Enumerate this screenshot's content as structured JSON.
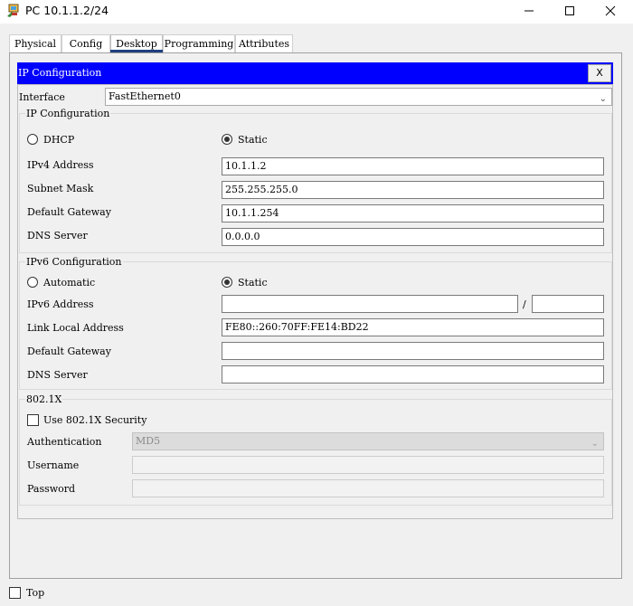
{
  "window": {
    "title": "PC 10.1.1.2/24"
  },
  "tabs": [
    "Physical",
    "Config",
    "Desktop",
    "Programming",
    "Attributes"
  ],
  "header": {
    "title": "IP Configuration",
    "close_label": "X"
  },
  "interface": {
    "label": "Interface",
    "value": "FastEthernet0"
  },
  "ipv4": {
    "group_title": "IP Configuration",
    "dhcp_label": "DHCP",
    "static_label": "Static",
    "address_label": "IPv4 Address",
    "address_value": "10.1.1.2",
    "mask_label": "Subnet Mask",
    "mask_value": "255.255.255.0",
    "gateway_label": "Default Gateway",
    "gateway_value": "10.1.1.254",
    "dns_label": "DNS Server",
    "dns_value": "0.0.0.0"
  },
  "ipv6": {
    "group_title": "IPv6 Configuration",
    "auto_label": "Automatic",
    "static_label": "Static",
    "address_label": "IPv6 Address",
    "address_value": "",
    "prefix_sep": "/",
    "prefix_value": "",
    "link_local_label": "Link Local Address",
    "link_local_value": "FE80::260:70FF:FE14:BD22",
    "gateway_label": "Default Gateway",
    "gateway_value": "",
    "dns_label": "DNS Server",
    "dns_value": ""
  },
  "dot1x": {
    "group_title": "802.1X",
    "use_label": "Use 802.1X Security",
    "auth_label": "Authentication",
    "auth_value": "MD5",
    "username_label": "Username",
    "username_value": "",
    "password_label": "Password",
    "password_value": ""
  },
  "footer": {
    "top_label": "Top"
  }
}
